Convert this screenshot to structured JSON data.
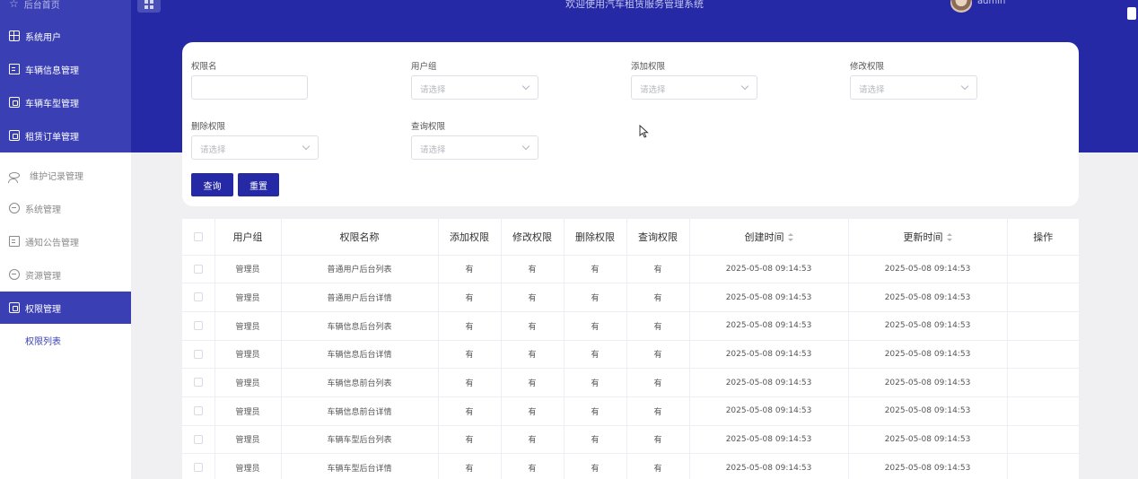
{
  "header": {
    "title": "欢迎使用汽车租赁服务管理系统",
    "username": "admin"
  },
  "sidebar": {
    "top_item": "后台首页",
    "items": [
      {
        "label": "系统用户",
        "icon": "grid-icon"
      },
      {
        "label": "车辆信息管理",
        "icon": "document-icon"
      },
      {
        "label": "车辆车型管理",
        "icon": "box-icon"
      },
      {
        "label": "租赁订单管理",
        "icon": "box-icon"
      },
      {
        "label": "维护记录管理",
        "icon": "user-icon"
      },
      {
        "label": "系统管理",
        "icon": "circle-icon"
      },
      {
        "label": "通知公告管理",
        "icon": "document-icon"
      },
      {
        "label": "资源管理",
        "icon": "circle-icon"
      },
      {
        "label": "权限管理",
        "icon": "box-icon"
      }
    ],
    "sub_item": "权限列表"
  },
  "search": {
    "fields": [
      {
        "label": "权限名",
        "value": "",
        "placeholder": ""
      },
      {
        "label": "用户组",
        "placeholder": "请选择"
      },
      {
        "label": "添加权限",
        "placeholder": "请选择"
      },
      {
        "label": "修改权限",
        "placeholder": "请选择"
      },
      {
        "label": "删除权限",
        "placeholder": "请选择"
      },
      {
        "label": "查询权限",
        "placeholder": "请选择"
      }
    ],
    "query_button": "查询",
    "reset_button": "重置"
  },
  "table": {
    "columns": [
      "用户组",
      "权限名称",
      "添加权限",
      "修改权限",
      "删除权限",
      "查询权限",
      "创建时间",
      "更新时间",
      "操作"
    ],
    "rows": [
      [
        "管理员",
        "普通用户后台列表",
        "有",
        "有",
        "有",
        "有",
        "2025-05-08 09:14:53",
        "2025-05-08 09:14:53",
        ""
      ],
      [
        "管理员",
        "普通用户后台详情",
        "有",
        "有",
        "有",
        "有",
        "2025-05-08 09:14:53",
        "2025-05-08 09:14:53",
        ""
      ],
      [
        "管理员",
        "车辆信息后台列表",
        "有",
        "有",
        "有",
        "有",
        "2025-05-08 09:14:53",
        "2025-05-08 09:14:53",
        ""
      ],
      [
        "管理员",
        "车辆信息后台详情",
        "有",
        "有",
        "有",
        "有",
        "2025-05-08 09:14:53",
        "2025-05-08 09:14:53",
        ""
      ],
      [
        "管理员",
        "车辆信息前台列表",
        "有",
        "有",
        "有",
        "有",
        "2025-05-08 09:14:53",
        "2025-05-08 09:14:53",
        ""
      ],
      [
        "管理员",
        "车辆信息前台详情",
        "有",
        "有",
        "有",
        "有",
        "2025-05-08 09:14:53",
        "2025-05-08 09:14:53",
        ""
      ],
      [
        "管理员",
        "车辆车型后台列表",
        "有",
        "有",
        "有",
        "有",
        "2025-05-08 09:14:53",
        "2025-05-08 09:14:53",
        ""
      ],
      [
        "管理员",
        "车辆车型后台详情",
        "有",
        "有",
        "有",
        "有",
        "2025-05-08 09:14:53",
        "2025-05-08 09:14:53",
        ""
      ]
    ]
  },
  "colors": {
    "primary": "#2529a5",
    "sidebar_blue": "#3a3fb4",
    "background": "#f0f0f3"
  }
}
